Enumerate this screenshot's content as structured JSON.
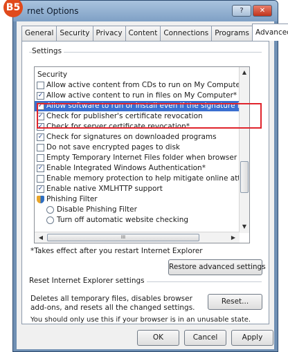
{
  "window": {
    "badge": "B5",
    "title": "rnet Options",
    "help_glyph": "?",
    "close_glyph": "✕"
  },
  "tabs": [
    "General",
    "Security",
    "Privacy",
    "Content",
    "Connections",
    "Programs",
    "Advanced"
  ],
  "settings": {
    "group_label": "Settings",
    "items": [
      {
        "kind": "heading",
        "label": "Security",
        "checked": false
      },
      {
        "kind": "checkbox",
        "label": "Allow active content from CDs to run on My Computer*",
        "checked": false
      },
      {
        "kind": "checkbox",
        "label": "Allow active content to run in files on My Computer*",
        "checked": true
      },
      {
        "kind": "checkbox",
        "label": "Allow software to run or install even if the signature is invalid",
        "checked": true,
        "highlighted": true
      },
      {
        "kind": "checkbox",
        "label": "Check for publisher's certificate revocation",
        "checked": true
      },
      {
        "kind": "checkbox",
        "label": "Check for server certificate revocation*",
        "checked": true
      },
      {
        "kind": "checkbox",
        "label": "Check for signatures on downloaded programs",
        "checked": true
      },
      {
        "kind": "checkbox",
        "label": "Do not save encrypted pages to disk",
        "checked": false
      },
      {
        "kind": "checkbox",
        "label": "Empty Temporary Internet Files folder when browser is close",
        "checked": false
      },
      {
        "kind": "checkbox",
        "label": "Enable Integrated Windows Authentication*",
        "checked": true
      },
      {
        "kind": "checkbox",
        "label": "Enable memory protection to help mitigate online attacks",
        "checked": false
      },
      {
        "kind": "checkbox",
        "label": "Enable native XMLHTTP support",
        "checked": true
      },
      {
        "kind": "subheading",
        "label": "Phishing Filter",
        "checked": false
      },
      {
        "kind": "radio",
        "label": "Disable Phishing Filter",
        "checked": false
      },
      {
        "kind": "radio",
        "label": "Turn off automatic website checking",
        "checked": false
      }
    ],
    "hscroll_grip": "III",
    "restart_note": "*Takes effect after you restart Internet Explorer",
    "restore_button": "Restore advanced settings"
  },
  "reset": {
    "group_label": "Reset Internet Explorer settings",
    "description_line1": "Deletes all temporary files, disables browser",
    "description_line2": "add-ons, and resets all the changed settings.",
    "reset_button": "Reset...",
    "warning": "You should only use this if your browser is in an unusable state."
  },
  "footer": {
    "ok": "OK",
    "cancel": "Cancel",
    "apply": "Apply"
  },
  "colors": {
    "selection": "#3a6fd0",
    "annotation_box": "#e0232b",
    "badge": "#e04a1c"
  }
}
